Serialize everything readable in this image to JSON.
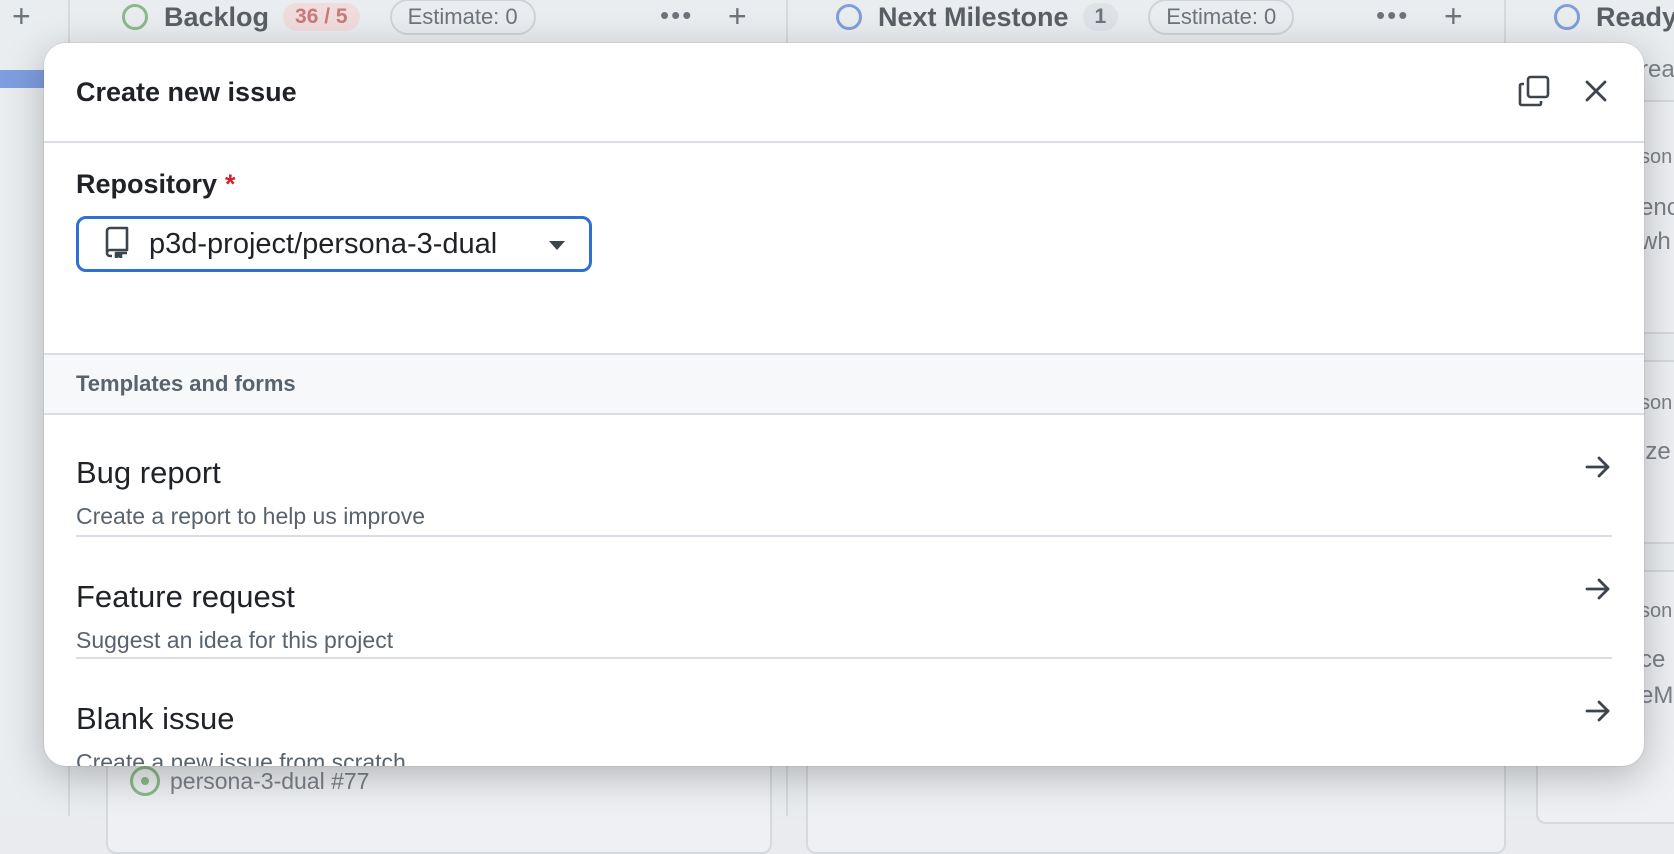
{
  "board": {
    "columns": [
      {
        "title": "Backlog",
        "count": "36 / 5",
        "estimate": "Estimate: 0",
        "more_icon": "kebab-horizontal-icon",
        "add_icon": "plus-icon",
        "status_color": "#8bb98a"
      },
      {
        "title": "Next Milestone",
        "count": "1",
        "estimate": "Estimate: 0",
        "more_icon": "kebab-horizontal-icon",
        "add_icon": "plus-icon",
        "status_color": "#7f9fd8"
      },
      {
        "title": "Ready",
        "status_color": "#7f9fd8"
      }
    ],
    "background_issue": {
      "text": "persona-3-dual #77"
    },
    "fragments": [
      "rea",
      "son",
      "enc",
      "wh",
      "son",
      "ize",
      "son",
      "ce",
      "eM"
    ]
  },
  "modal": {
    "title": "Create new issue",
    "header_icons": [
      "copy-icon",
      "close-icon"
    ],
    "repository": {
      "label": "Repository",
      "required_mark": "*",
      "selected": "p3d-project/persona-3-dual",
      "icon": "repo-icon"
    },
    "templates": {
      "heading": "Templates and forms",
      "items": [
        {
          "title": "Bug report",
          "description": "Create a report to help us improve"
        },
        {
          "title": "Feature request",
          "description": "Suggest an idea for this project"
        },
        {
          "title": "Blank issue",
          "description": "Create a new issue from scratch"
        }
      ]
    }
  },
  "colors": {
    "accent": "#2f6fd6",
    "required": "#cf222e"
  }
}
